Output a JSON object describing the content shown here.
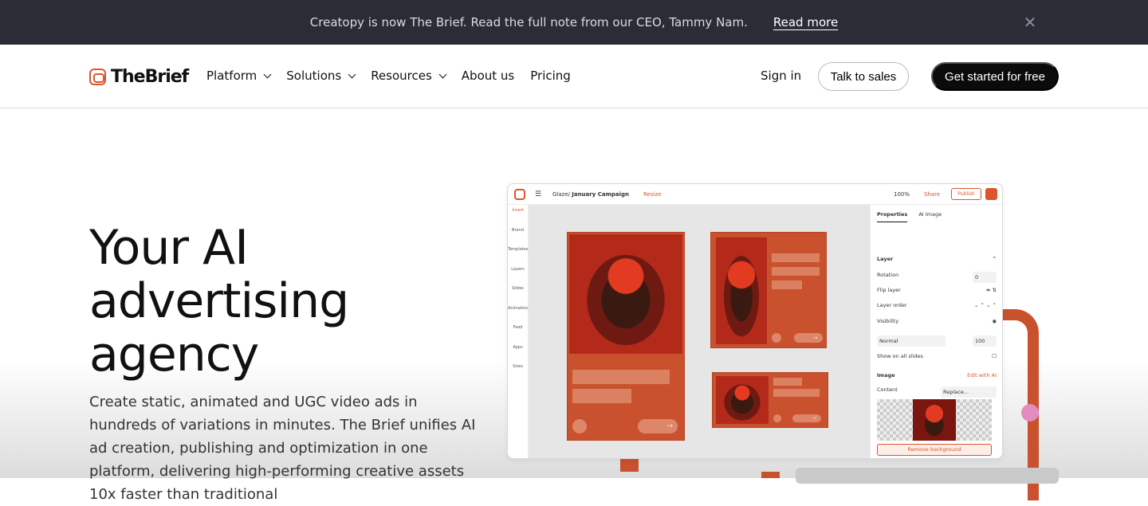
{
  "banner": {
    "message": "Creatopy is now The Brief. Read the full note from our CEO, Tammy Nam.",
    "link": "Read more",
    "close_icon": "close-icon"
  },
  "nav": {
    "logo_text": "TheBrief",
    "items": [
      {
        "label": "Platform",
        "dropdown": true
      },
      {
        "label": "Solutions",
        "dropdown": true
      },
      {
        "label": "Resources",
        "dropdown": true
      },
      {
        "label": "About us",
        "dropdown": false
      },
      {
        "label": "Pricing",
        "dropdown": false
      }
    ],
    "signin": "Sign in",
    "talk": "Talk to sales",
    "cta": "Get started for free"
  },
  "hero": {
    "title": "Your AI advertising agency",
    "subtitle": "Create static, animated and UGC video ads in hundreds of variations in minutes. The Brief unifies AI ad creation, publishing and optimization in one platform, delivering high-performing creative assets 10x faster than traditional"
  },
  "app": {
    "breadcrumb_parent": "Glaze/",
    "breadcrumb_current": "January Campaign",
    "resize": "Resize",
    "zoom": "100%",
    "share": "Share",
    "publish": "Publish",
    "tools": [
      "Insert",
      "Brand",
      "Templates",
      "Layers",
      "Slides",
      "Animation",
      "Feed",
      "Apps",
      "Sizes"
    ],
    "panel": {
      "tab_properties": "Properties",
      "tab_ai_image": "AI Image",
      "layer": "Layer",
      "rotation": "Rotation",
      "rotation_value": "0",
      "flip_layer": "Flip layer",
      "layer_order": "Layer order",
      "visibility": "Visibility",
      "blend": "Normal",
      "opacity": "100",
      "show_all": "Show on all slides",
      "image": "Image",
      "edit_ai": "Edit with AI",
      "content": "Content",
      "replace": "Replace...",
      "remove_bg": "Remove background"
    }
  },
  "colors": {
    "accent": "#d9562f",
    "banner_bg": "#2b2d36",
    "cta_bg": "#0b0b0b"
  }
}
